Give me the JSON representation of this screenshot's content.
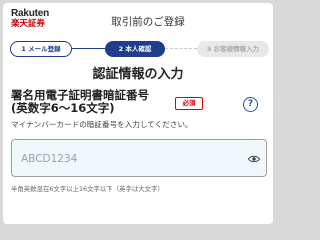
{
  "header": {
    "logo_line1": "Rakuten",
    "logo_line2": "楽天証券",
    "title": "取引前のご登録"
  },
  "steps": [
    {
      "label": "1 メール登録",
      "state": "done"
    },
    {
      "label": "2 本人確認",
      "state": "current"
    },
    {
      "label": "3 お客様情報入力",
      "state": "upcoming"
    }
  ],
  "page_title": "認証情報の入力",
  "field": {
    "label": "署名用電子証明書暗証番号\n(英数字6～16文字)",
    "required_badge": "必須",
    "help_icon": "question-circle",
    "description": "マイナンバーカードの暗証番号を入力してください。",
    "placeholder": "ABCD1234",
    "value": "",
    "toggle_icon": "eye",
    "hint": "半角英数混在6文字以上16文字以下（英字は大文字）"
  },
  "colors": {
    "brand_red": "#bf0000",
    "step_blue": "#1f3d8a",
    "required_red": "#dd0000",
    "input_bg": "#f1f8fb"
  }
}
